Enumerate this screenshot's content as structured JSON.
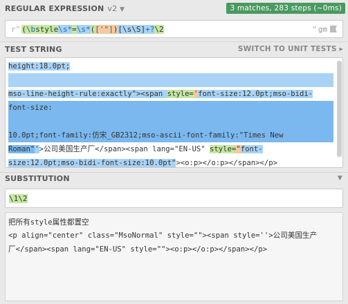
{
  "regex_header": {
    "title": "REGULAR EXPRESSION",
    "version": "v2",
    "match_info": "3 matches, 283 steps (~0ms)"
  },
  "regex": {
    "prefix": "r\"",
    "parts": [
      "(",
      "\\b",
      "style",
      "\\s*",
      "=",
      "\\s*",
      "(",
      "['\"]",
      ")",
      "[\\s\\S]",
      "+?",
      "\\2"
    ],
    "suffix": "\"",
    "flags": "gm"
  },
  "test_header": {
    "title": "TEST STRING",
    "switch_label": "SWITCH TO UNIT TESTS"
  },
  "test_lines": {
    "l1": "height:18.0pt;",
    "l3a": "mso-line-height-rule:exactly\"><span ",
    "l3b": "style=",
    "l3c": "'",
    "l3d": "font-size:12.0pt;mso-bidi-",
    "l4": "font-size:",
    "l6": "10.0pt;font-family:仿宋_GB2312;mso-ascii-font-family:\"Times New",
    "l7a": "Roman\"",
    "l7b": "'",
    "l7c": ">公司美国生产厂</span><span lang=\"EN-US\" ",
    "l7d": "style=",
    "l7e": "\"",
    "l7f": "font-",
    "l8a": "size:12.0pt;mso-bidi-font-size:10.0pt\"",
    "l8b": "><o:p></o:p></span></p>"
  },
  "substitution": {
    "title": "SUBSTITUTION",
    "value": "\\1\\2"
  },
  "result_lines": [
    "把所有style属性都置空",
    "<p align=\"center\" class=\"MsoNormal\" style=\"\"><span style=''>公司美国生产",
    "厂</span><span lang=\"EN-US\" style=\"\"><o:p></o:p></span></p>"
  ]
}
